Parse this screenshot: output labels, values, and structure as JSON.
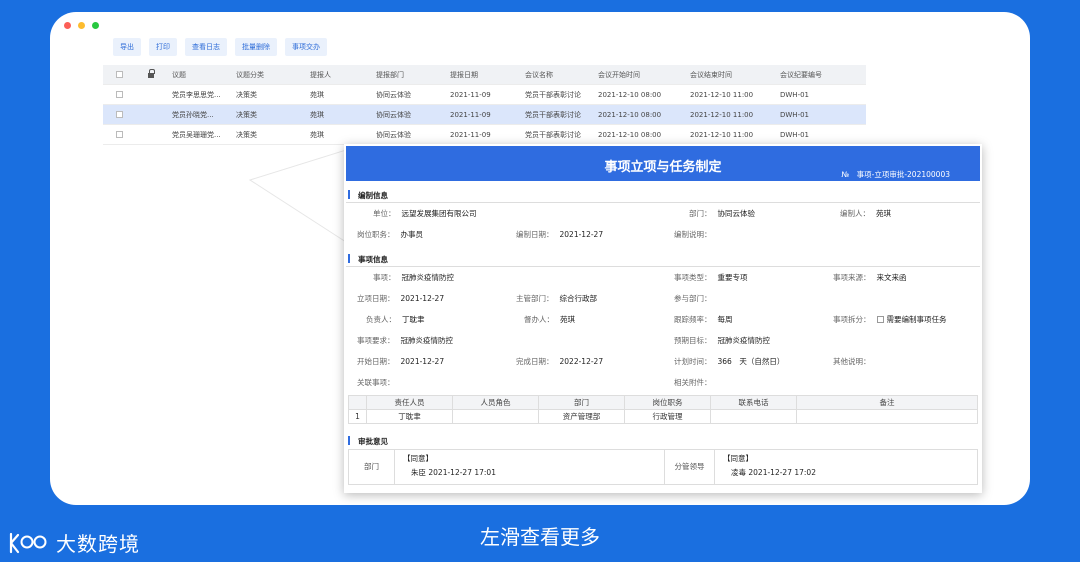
{
  "colors": {
    "background": "#1a6fe0",
    "accent": "#2f6ce0",
    "selected_row": "#dbe6fb"
  },
  "toolbar": [
    "导出",
    "打印",
    "查看日志",
    "批量删除",
    "事项交办"
  ],
  "grid": {
    "headers": [
      "议题",
      "议题分类",
      "提报人",
      "提报部门",
      "提报日期",
      "会议名称",
      "会议开始时间",
      "会议结束时间",
      "会议纪要编号"
    ],
    "rows": [
      [
        "党员李思思党...",
        "决策类",
        "苑琪",
        "协同云体验",
        "2021-11-09",
        "党员干部表彰讨论",
        "2021-12-10 08:00",
        "2021-12-10 11:00",
        "DWH-01"
      ],
      [
        "党员孙晓党...",
        "决策类",
        "苑琪",
        "协同云体验",
        "2021-11-09",
        "党员干部表彰讨论",
        "2021-12-10 08:00",
        "2021-12-10 11:00",
        "DWH-01"
      ],
      [
        "党员吴珊珊党...",
        "决策类",
        "苑琪",
        "协同云体验",
        "2021-11-09",
        "党员干部表彰讨论",
        "2021-12-10 08:00",
        "2021-12-10 11:00",
        "DWH-01"
      ]
    ],
    "selected_row": 2
  },
  "doc": {
    "title": "事项立项与任务制定",
    "number": "№　事项-立项审批-202100003",
    "section1": "编制信息",
    "unit_label": "单位：",
    "unit": "远望发展集团有限公司",
    "dept_label": "部门：",
    "dept": "协同云体验",
    "author_label": "编制人：",
    "author": "苑琪",
    "post_label": "岗位职务：",
    "post": "办事员",
    "date_label": "编制日期：",
    "date": "2021-12-27",
    "desc_label": "编制说明：",
    "section2": "事项信息",
    "item_label": "事项：",
    "item": "冠肺炎疫情防控",
    "type_label": "事项类型：",
    "type": "重要专项",
    "source_label": "事项来源：",
    "source": "来文来函",
    "setup_label": "立项日期：",
    "setup": "2021-12-27",
    "mdept_label": "主管部门：",
    "mdept": "综合行政部",
    "join_label": "参与部门：",
    "owner_label": "负责人：",
    "owner": "丁耽聿",
    "super_label": "督办人：",
    "super": "苑琪",
    "freq_label": "跟踪频率：",
    "freq": "每周",
    "split_label": "事项拆分：",
    "split": "需要编制事项任务",
    "req_label": "事项要求：",
    "req": "冠肺炎疫情防控",
    "goal_label": "预期目标：",
    "goal": "冠肺炎疫情防控",
    "start_label": "开始日期：",
    "start": "2021-12-27",
    "end_label": "完成日期：",
    "end": "2022-12-27",
    "plan_label": "计划时间：",
    "plan": "366　天（自然日）",
    "other_label": "其他说明：",
    "rel_label": "关联事项：",
    "att_label": "相关附件：",
    "table_headers": [
      "",
      "责任人员",
      "人员角色",
      "部门",
      "岗位职务",
      "联系电话",
      "备注"
    ],
    "table_rows": [
      [
        "1",
        "丁耽聿",
        "",
        "资产管理部",
        "行政管理",
        "",
        ""
      ]
    ],
    "section3": "审批意见",
    "ap_dept_label": "部门",
    "ap_dept_opinion": "【同意】",
    "ap_dept_sign": "朱臣 2021-12-27 17:01",
    "ap_lead_label": "分管领导",
    "ap_lead_opinion": "【同意】",
    "ap_lead_sign": "凌毒 2021-12-27 17:02"
  },
  "caption": "左滑查看更多",
  "brand": "大数跨境"
}
